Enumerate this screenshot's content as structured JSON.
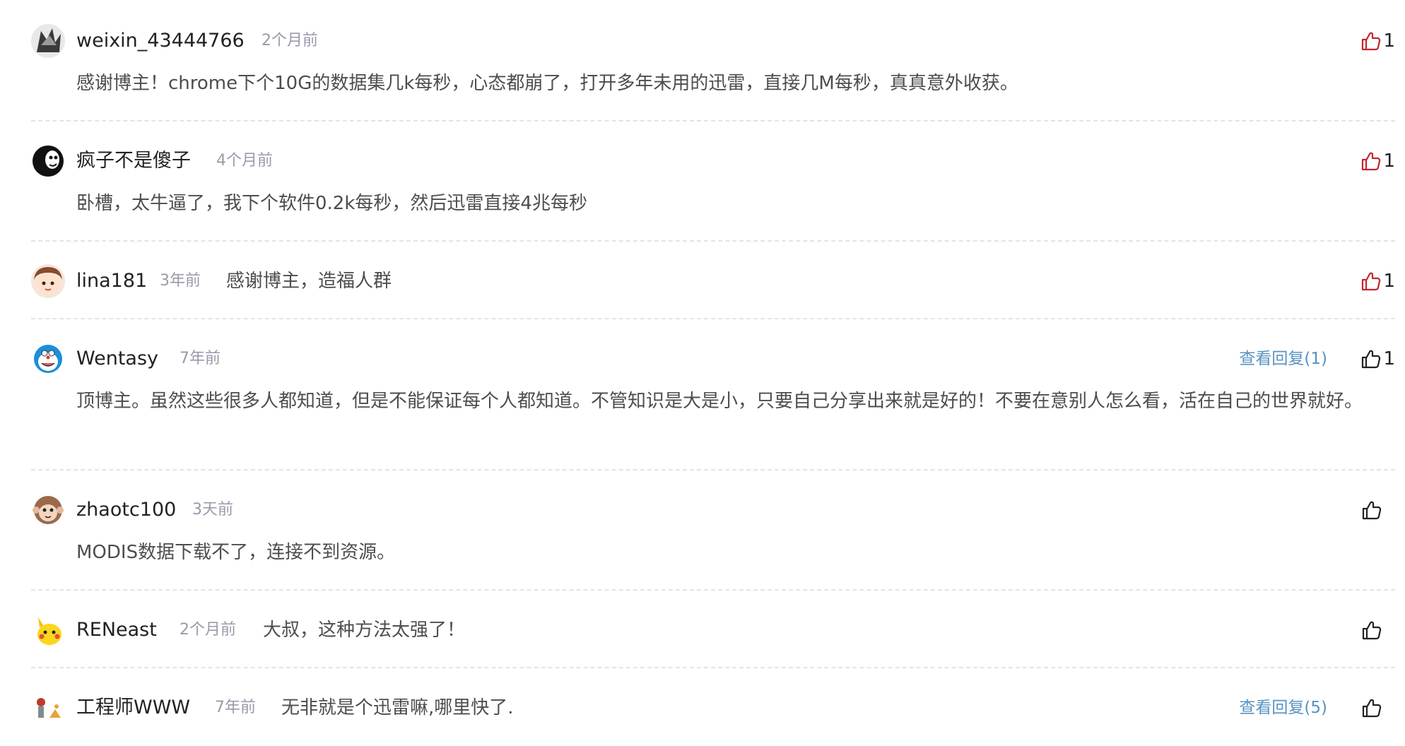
{
  "comments": [
    {
      "author": "weixin_43444766",
      "time": "2个月前",
      "text": "感谢博主！chrome下个10G的数据集几k每秒，心态都崩了，打开多年未用的迅雷，直接几M每秒，真真意外收获。",
      "likes": "1",
      "liked": true
    },
    {
      "author": "疯子不是傻子",
      "time": "4个月前",
      "text": "卧槽，太牛逼了，我下个软件0.2k每秒，然后迅雷直接4兆每秒",
      "likes": "1",
      "liked": true
    },
    {
      "author": "lina181",
      "time": "3年前",
      "text": "感谢博主，造福人群",
      "likes": "1",
      "liked": true
    },
    {
      "author": "Wentasy",
      "time": "7年前",
      "text": "顶博主。虽然这些很多人都知道，但是不能保证每个人都知道。不管知识是大是小，只要自己分享出来就是好的！不要在意别人怎么看，活在自己的世界就好。",
      "reply_link": "查看回复(1)",
      "likes": "1",
      "liked": false
    },
    {
      "author": "zhaotc100",
      "time": "3天前",
      "text": "MODIS数据下载不了，连接不到资源。",
      "likes": "",
      "liked": false
    },
    {
      "author": "RENeast",
      "time": "2个月前",
      "text": "大叔，这种方法太强了！",
      "likes": "",
      "liked": false
    },
    {
      "author": "工程师WWW",
      "time": "7年前",
      "text": "无非就是个迅雷嘛,哪里快了.",
      "reply_link": "查看回复(5)",
      "likes": "",
      "liked": false
    }
  ],
  "colors": {
    "liked": "#c1272d",
    "unliked": "#222226",
    "reply_link": "#5893c2",
    "time": "#999aaa"
  },
  "icons": {
    "like": "thumbs-up-icon"
  }
}
